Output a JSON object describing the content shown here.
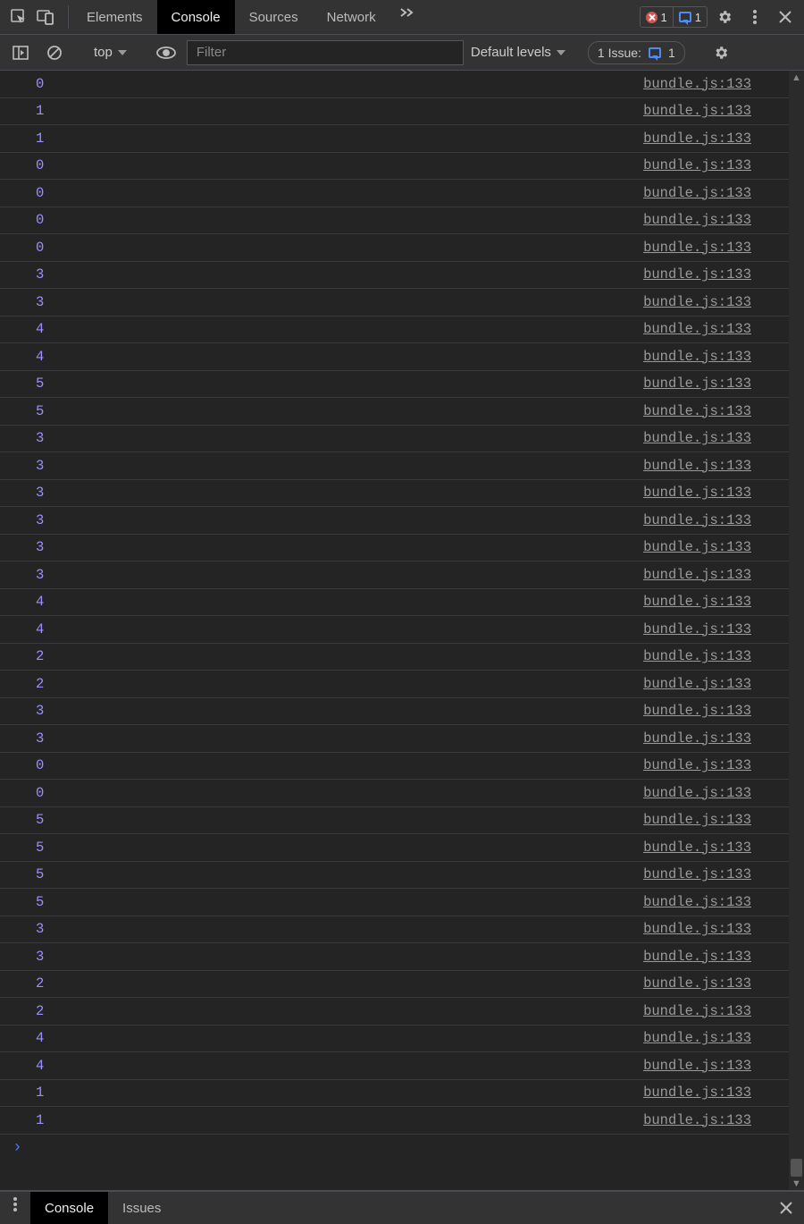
{
  "tabs": {
    "elements": "Elements",
    "console": "Console",
    "sources": "Sources",
    "network": "Network"
  },
  "badges": {
    "error_count": "1",
    "info_count": "1"
  },
  "toolbar": {
    "context": "top",
    "filter_placeholder": "Filter",
    "levels_label": "Default levels",
    "issues_label": "1 Issue:",
    "issues_count": "1"
  },
  "log": {
    "source": "bundle.js:133",
    "values": [
      "0",
      "1",
      "1",
      "0",
      "0",
      "0",
      "0",
      "3",
      "3",
      "4",
      "4",
      "5",
      "5",
      "3",
      "3",
      "3",
      "3",
      "3",
      "3",
      "4",
      "4",
      "2",
      "2",
      "3",
      "3",
      "0",
      "0",
      "5",
      "5",
      "5",
      "5",
      "3",
      "3",
      "2",
      "2",
      "4",
      "4",
      "1",
      "1"
    ]
  },
  "drawer": {
    "console": "Console",
    "issues": "Issues"
  }
}
